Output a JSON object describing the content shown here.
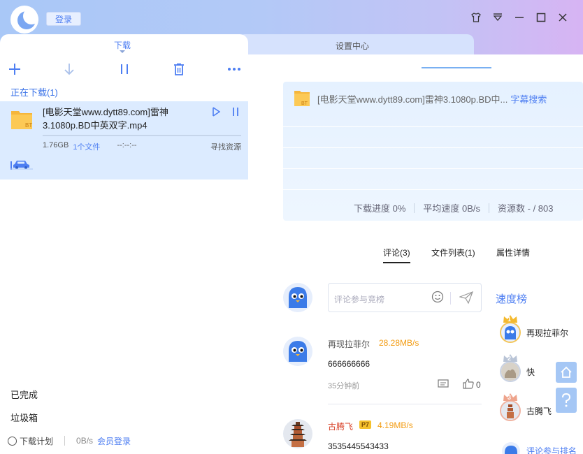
{
  "header": {
    "login_label": "登录",
    "window_icons": [
      "skin-icon",
      "menu-dropdown-icon",
      "minimize-icon",
      "maximize-icon",
      "close-icon"
    ]
  },
  "tabs": {
    "download": "下载",
    "settings": "设置中心"
  },
  "toolbar": {
    "icons": [
      "add-icon",
      "start-download-icon",
      "pause-icon",
      "delete-icon",
      "more-icon"
    ]
  },
  "sidebar": {
    "downloading_title": "正在下载(1)",
    "completed": "已完成",
    "trash": "垃圾箱"
  },
  "download_item": {
    "name": "[电影天堂www.dytt89.com]雷神3.1080p.BD中英双字.mp4",
    "size": "1.76GB",
    "file_count": "1个文件",
    "remaining": "--:--:--",
    "find_source": "寻找资源",
    "progress": 0
  },
  "status_bar": {
    "schedule": "下载计划",
    "speed": "0B/s",
    "vip_login": "会员登录"
  },
  "info_card": {
    "title": "[电影天堂www.dytt89.com]雷神3.1080p.BD中...",
    "subtitle_link": "字幕搜索",
    "progress": "下载进度 0%",
    "avg_speed": "平均速度 0B/s",
    "sources": "资源数 - / 803"
  },
  "comment_tabs": {
    "comments": "评论(3)",
    "file_list": "文件列表(1)",
    "properties": "属性详情"
  },
  "comment_input": {
    "placeholder": "评论参与竞榜"
  },
  "comments": [
    {
      "user": "再现拉菲尔",
      "speed": "28.28MB/s",
      "text": "666666666",
      "time": "35分钟前",
      "likes": "0"
    },
    {
      "user": "古腾飞",
      "badge": "P7",
      "speed": "4.19MB/s",
      "text": "3535445543433"
    }
  ],
  "ranking": {
    "title": "速度榜",
    "items": [
      {
        "rank": "1",
        "name": "再现拉菲尔"
      },
      {
        "rank": "2",
        "name": "快"
      },
      {
        "rank": "3",
        "name": "古腾飞"
      }
    ],
    "more": "评论参与排名"
  },
  "colors": {
    "accent": "#4d7ef2",
    "selected_bg": "#dcebff",
    "speed_orange": "#f39c12",
    "username_red": "#d9442b"
  }
}
